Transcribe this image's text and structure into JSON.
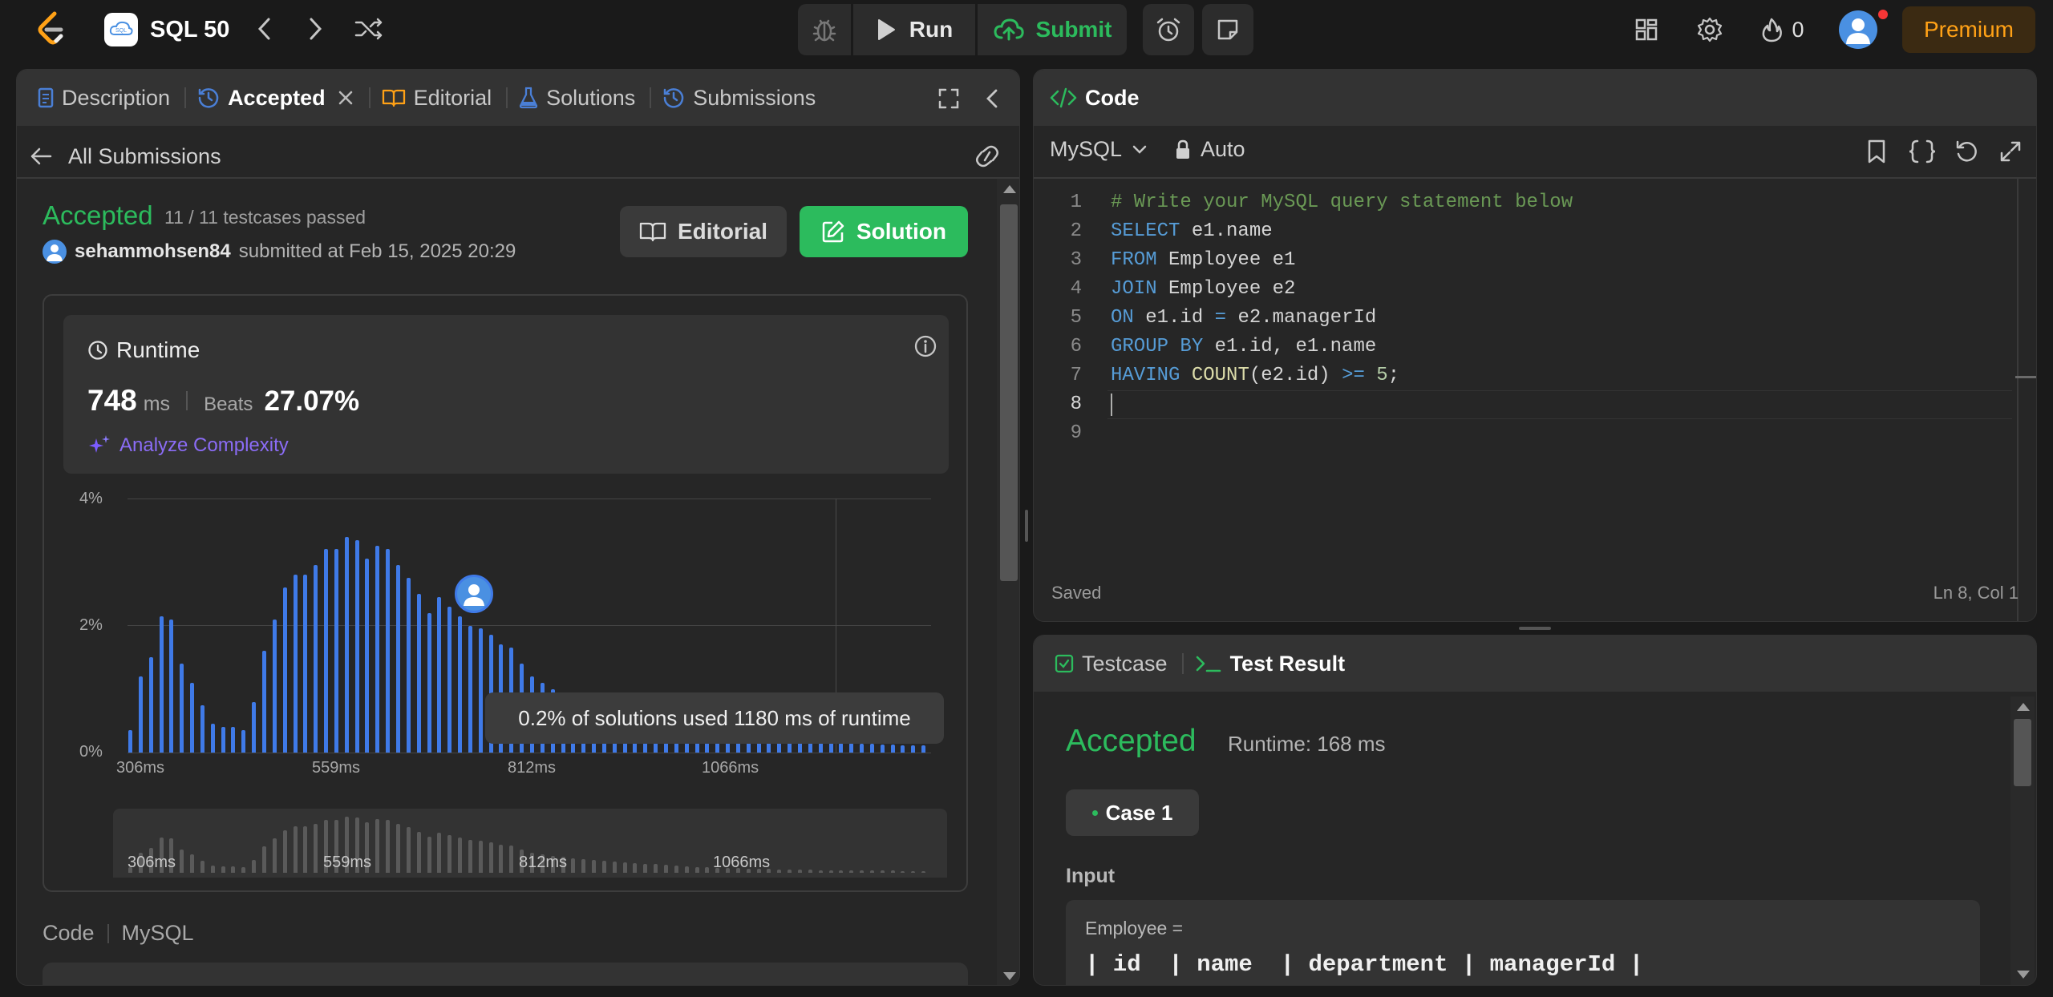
{
  "topbar": {
    "title": "SQL 50",
    "run_label": "Run",
    "submit_label": "Submit",
    "streak_count": "0",
    "premium_label": "Premium"
  },
  "left_tabs": {
    "description": "Description",
    "accepted": "Accepted",
    "editorial": "Editorial",
    "solutions": "Solutions",
    "submissions": "Submissions"
  },
  "submission": {
    "back_label": "All Submissions",
    "status": "Accepted",
    "testcases": "11 / 11 testcases passed",
    "username": "sehammohsen84",
    "submitted_text": "submitted at Feb 15, 2025 20:29",
    "editorial_btn": "Editorial",
    "solution_btn": "Solution"
  },
  "runtime": {
    "label": "Runtime",
    "value": "748",
    "unit": "ms",
    "beats_label": "Beats",
    "beats_value": "27.07%",
    "analyze_label": "Analyze Complexity"
  },
  "chart_data": {
    "type": "bar",
    "y_ticks": [
      "4%",
      "2%",
      "0%"
    ],
    "x_ticks": [
      "306ms",
      "559ms",
      "812ms",
      "1066ms"
    ],
    "ylim": [
      0,
      4
    ],
    "values": [
      0.35,
      1.2,
      1.5,
      2.15,
      2.1,
      1.4,
      1.1,
      0.75,
      0.45,
      0.4,
      0.4,
      0.35,
      0.8,
      1.6,
      2.1,
      2.6,
      2.8,
      2.8,
      2.95,
      3.2,
      3.2,
      3.4,
      3.35,
      3.05,
      3.25,
      3.2,
      2.95,
      2.75,
      2.5,
      2.2,
      2.45,
      2.3,
      2.15,
      2.0,
      1.95,
      1.85,
      1.7,
      1.65,
      1.4,
      1.2,
      1.1,
      1.0,
      0.95,
      0.9,
      0.85,
      0.8,
      0.72,
      0.7,
      0.65,
      0.6,
      0.55,
      0.52,
      0.48,
      0.45,
      0.4,
      0.36,
      0.32,
      0.3,
      0.28,
      0.27,
      0.25,
      0.24,
      0.22,
      0.2,
      0.2,
      0.19,
      0.18,
      0.17,
      0.16,
      0.15,
      0.15,
      0.14,
      0.14,
      0.13,
      0.13,
      0.12,
      0.12,
      0.12
    ],
    "tooltip": "0.2% of solutions used 1180 ms of runtime"
  },
  "code_section": {
    "label": "Code",
    "lang": "MySQL"
  },
  "editor": {
    "title": "Code",
    "language": "MySQL",
    "auto_label": "Auto",
    "status": "Saved",
    "position": "Ln 8, Col 1",
    "line_numbers": [
      "1",
      "2",
      "3",
      "4",
      "5",
      "6",
      "7",
      "8",
      "9"
    ]
  },
  "testpanel": {
    "testcase_tab": "Testcase",
    "result_tab": "Test Result",
    "status": "Accepted",
    "runtime": "Runtime: 168 ms",
    "case_label": "Case 1",
    "input_label": "Input",
    "input_var": "Employee =",
    "input_table_header": "| id  | name  | department | managerId |"
  },
  "colors": {
    "accent_green": "#2cbb5d",
    "accent_blue": "#3f7ae8",
    "premium": "#ffa116"
  }
}
